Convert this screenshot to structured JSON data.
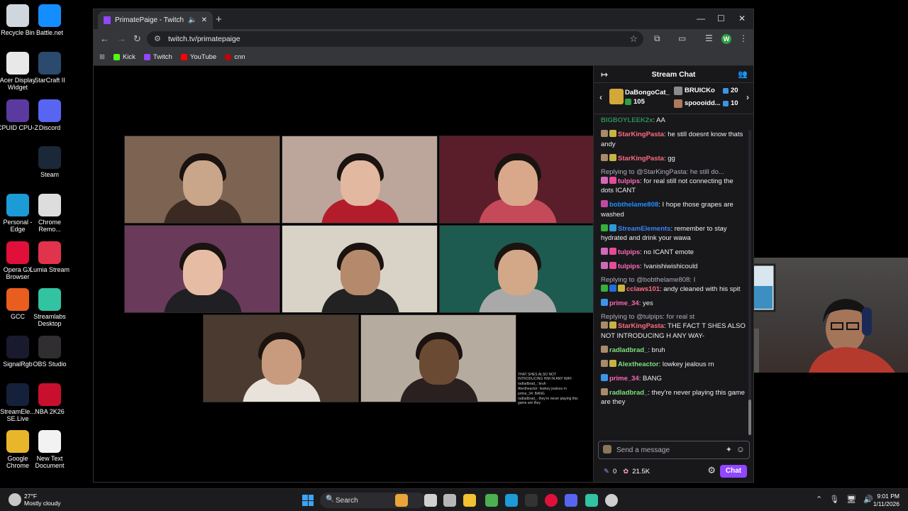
{
  "desktop": {
    "icons": [
      {
        "label": "Recycle Bin",
        "icon": "recycle-bin-icon",
        "color": "#cfd6de"
      },
      {
        "label": "Battle.net",
        "icon": "battlenet-icon",
        "color": "#148eff"
      },
      {
        "label": "Acer Display Widget",
        "icon": "acer-display-icon",
        "color": "#e8e8e8"
      },
      {
        "label": "StarCraft II",
        "icon": "starcraft-icon",
        "color": "#2b4a6d"
      },
      {
        "label": "CPUID CPU-Z",
        "icon": "cpuz-icon",
        "color": "#5b3aa0"
      },
      {
        "label": "Discord",
        "icon": "discord-icon",
        "color": "#5865f2"
      },
      {
        "label": "Steam",
        "icon": "steam-icon",
        "color": "#1b2838"
      },
      {
        "label": "Personal - Edge",
        "icon": "edge-icon",
        "color": "#1c9bd6"
      },
      {
        "label": "Chrome Remo...",
        "icon": "chrome-remote-icon",
        "color": "#dddddd"
      },
      {
        "label": "Opera GX Browser",
        "icon": "opera-gx-icon",
        "color": "#e0103a"
      },
      {
        "label": "Lumia Stream",
        "icon": "lumia-icon",
        "color": "#e2334d"
      },
      {
        "label": "GCC",
        "icon": "gcc-icon",
        "color": "#e95e1e"
      },
      {
        "label": "Streamlabs Desktop",
        "icon": "streamlabs-icon",
        "color": "#31c3a2"
      },
      {
        "label": "SignalRgb",
        "icon": "signalrgb-icon",
        "color": "#1a1a2e"
      },
      {
        "label": "OBS Studio",
        "icon": "obs-icon",
        "color": "#302e31"
      },
      {
        "label": "StreamEle... SE.Live",
        "icon": "streamelements-icon",
        "color": "#15213a"
      },
      {
        "label": "NBA 2K26",
        "icon": "nba2k-icon",
        "color": "#c8102e"
      },
      {
        "label": "Google Chrome",
        "icon": "chrome-icon",
        "color": "#e9b62b"
      },
      {
        "label": "New Text Document",
        "icon": "text-document-icon",
        "color": "#f2f2f2"
      }
    ]
  },
  "browser": {
    "tab_title": "PrimatePaige - Twitch",
    "url": "twitch.tv/primatepaige",
    "bookmarks": [
      {
        "label": "Kick",
        "color": "#53fc18"
      },
      {
        "label": "Twitch",
        "color": "#9146ff"
      },
      {
        "label": "YouTube",
        "color": "#ff0000"
      },
      {
        "label": "cnn",
        "color": "#cc0000"
      }
    ],
    "profile_initial": "W"
  },
  "stream": {
    "mini_chat": [
      "THAT SHES ALSO NOT INTRODUCING HIM IN ANY WAY-",
      "radladbrad_: bruh",
      "Alextheactor: lowkey jealous rn",
      "prime_34: BANG",
      "radladbrad_: they're never playing this game are they"
    ]
  },
  "chat": {
    "title": "Stream Chat",
    "gift": {
      "top_user": "DaBongoCat_",
      "top_count": "105",
      "second_user": "BRUICKo",
      "second_count": "20",
      "third_user": "spoooidd...",
      "third_count": "10"
    },
    "messages": [
      {
        "user": "BIGBOYLEEK2x",
        "color": "#2e8b57",
        "text": ": AA",
        "badges": []
      },
      {
        "user": "StarKingPasta",
        "color": "#ff6b81",
        "text": ": he still doesnt know thats andy",
        "badges": [
          "#a98a6a",
          "#c9b340"
        ]
      },
      {
        "user": "StarKingPasta",
        "color": "#ff6b81",
        "text": ": gg",
        "badges": [
          "#a98a6a",
          "#c9b340"
        ]
      },
      {
        "reply": "Replying to @StarKingPasta: he still do...",
        "user": "tulpips",
        "color": "#ff69b4",
        "text": ": for real still not connecting the dots ICANT",
        "badges": [
          "#d06ab5",
          "#e84a9a"
        ]
      },
      {
        "user": "bobthelame808",
        "color": "#1e90ff",
        "text": ": I hope those grapes are washed",
        "badges": [
          "#c04aa0"
        ]
      },
      {
        "user": "StreamElements",
        "color": "#3b82f6",
        "text": ": remember to stay hydrated and drink your wawa",
        "badges": [
          "#3aad3a",
          "#2b9bd6"
        ]
      },
      {
        "user": "tulpips",
        "color": "#ff69b4",
        "text": ": no ICANT emote",
        "badges": [
          "#d06ab5",
          "#e84a9a"
        ]
      },
      {
        "user": "tulpips",
        "color": "#ff69b4",
        "text": ": !vanishiwishicould",
        "badges": [
          "#d06ab5",
          "#e84a9a"
        ]
      },
      {
        "reply": "Replying to @bobthelame808: I",
        "user": "cclaws101",
        "color": "#ff6b81",
        "text": ": andy cleaned with his spit",
        "badges": [
          "#3aad3a",
          "#1e6fd9",
          "#c9b340"
        ]
      },
      {
        "user": "prime_34",
        "color": "#ff69b4",
        "text": ": yes",
        "badges": [
          "#3a95e8"
        ]
      },
      {
        "reply": "Replying to @tulpips: for real st",
        "user": "StarKingPasta",
        "color": "#ff6b81",
        "text": ": THE FACT T SHES ALSO NOT INTRODUCING H ANY WAY-",
        "badges": [
          "#a98a6a",
          "#c9b340"
        ]
      },
      {
        "user": "radladbrad_",
        "color": "#7ee07e",
        "text": ": bruh",
        "badges": [
          "#a98a6a"
        ]
      },
      {
        "user": "Alextheactor",
        "color": "#7ee07e",
        "text": ": lowkey jealous rn",
        "badges": [
          "#a98a6a",
          "#c9b340"
        ]
      },
      {
        "user": "prime_34",
        "color": "#ff69b4",
        "text": ": BANG",
        "badges": [
          "#3a95e8"
        ]
      },
      {
        "user": "radladbrad_",
        "color": "#7ee07e",
        "text": ": they're never playing this game are they",
        "badges": [
          "#a98a6a"
        ]
      }
    ],
    "input_placeholder": "Send a message",
    "bits": "0",
    "points": "21.5K",
    "chat_button": "Chat"
  },
  "taskbar": {
    "temp": "27°F",
    "weather": "Mostly cloudy",
    "search": "Search",
    "time": "9:01 PM",
    "date": "1/11/2026"
  },
  "colors": {
    "twitch_purple": "#9147ff",
    "chat_bg": "#18181b",
    "start_blue": "#3fa3f3"
  }
}
